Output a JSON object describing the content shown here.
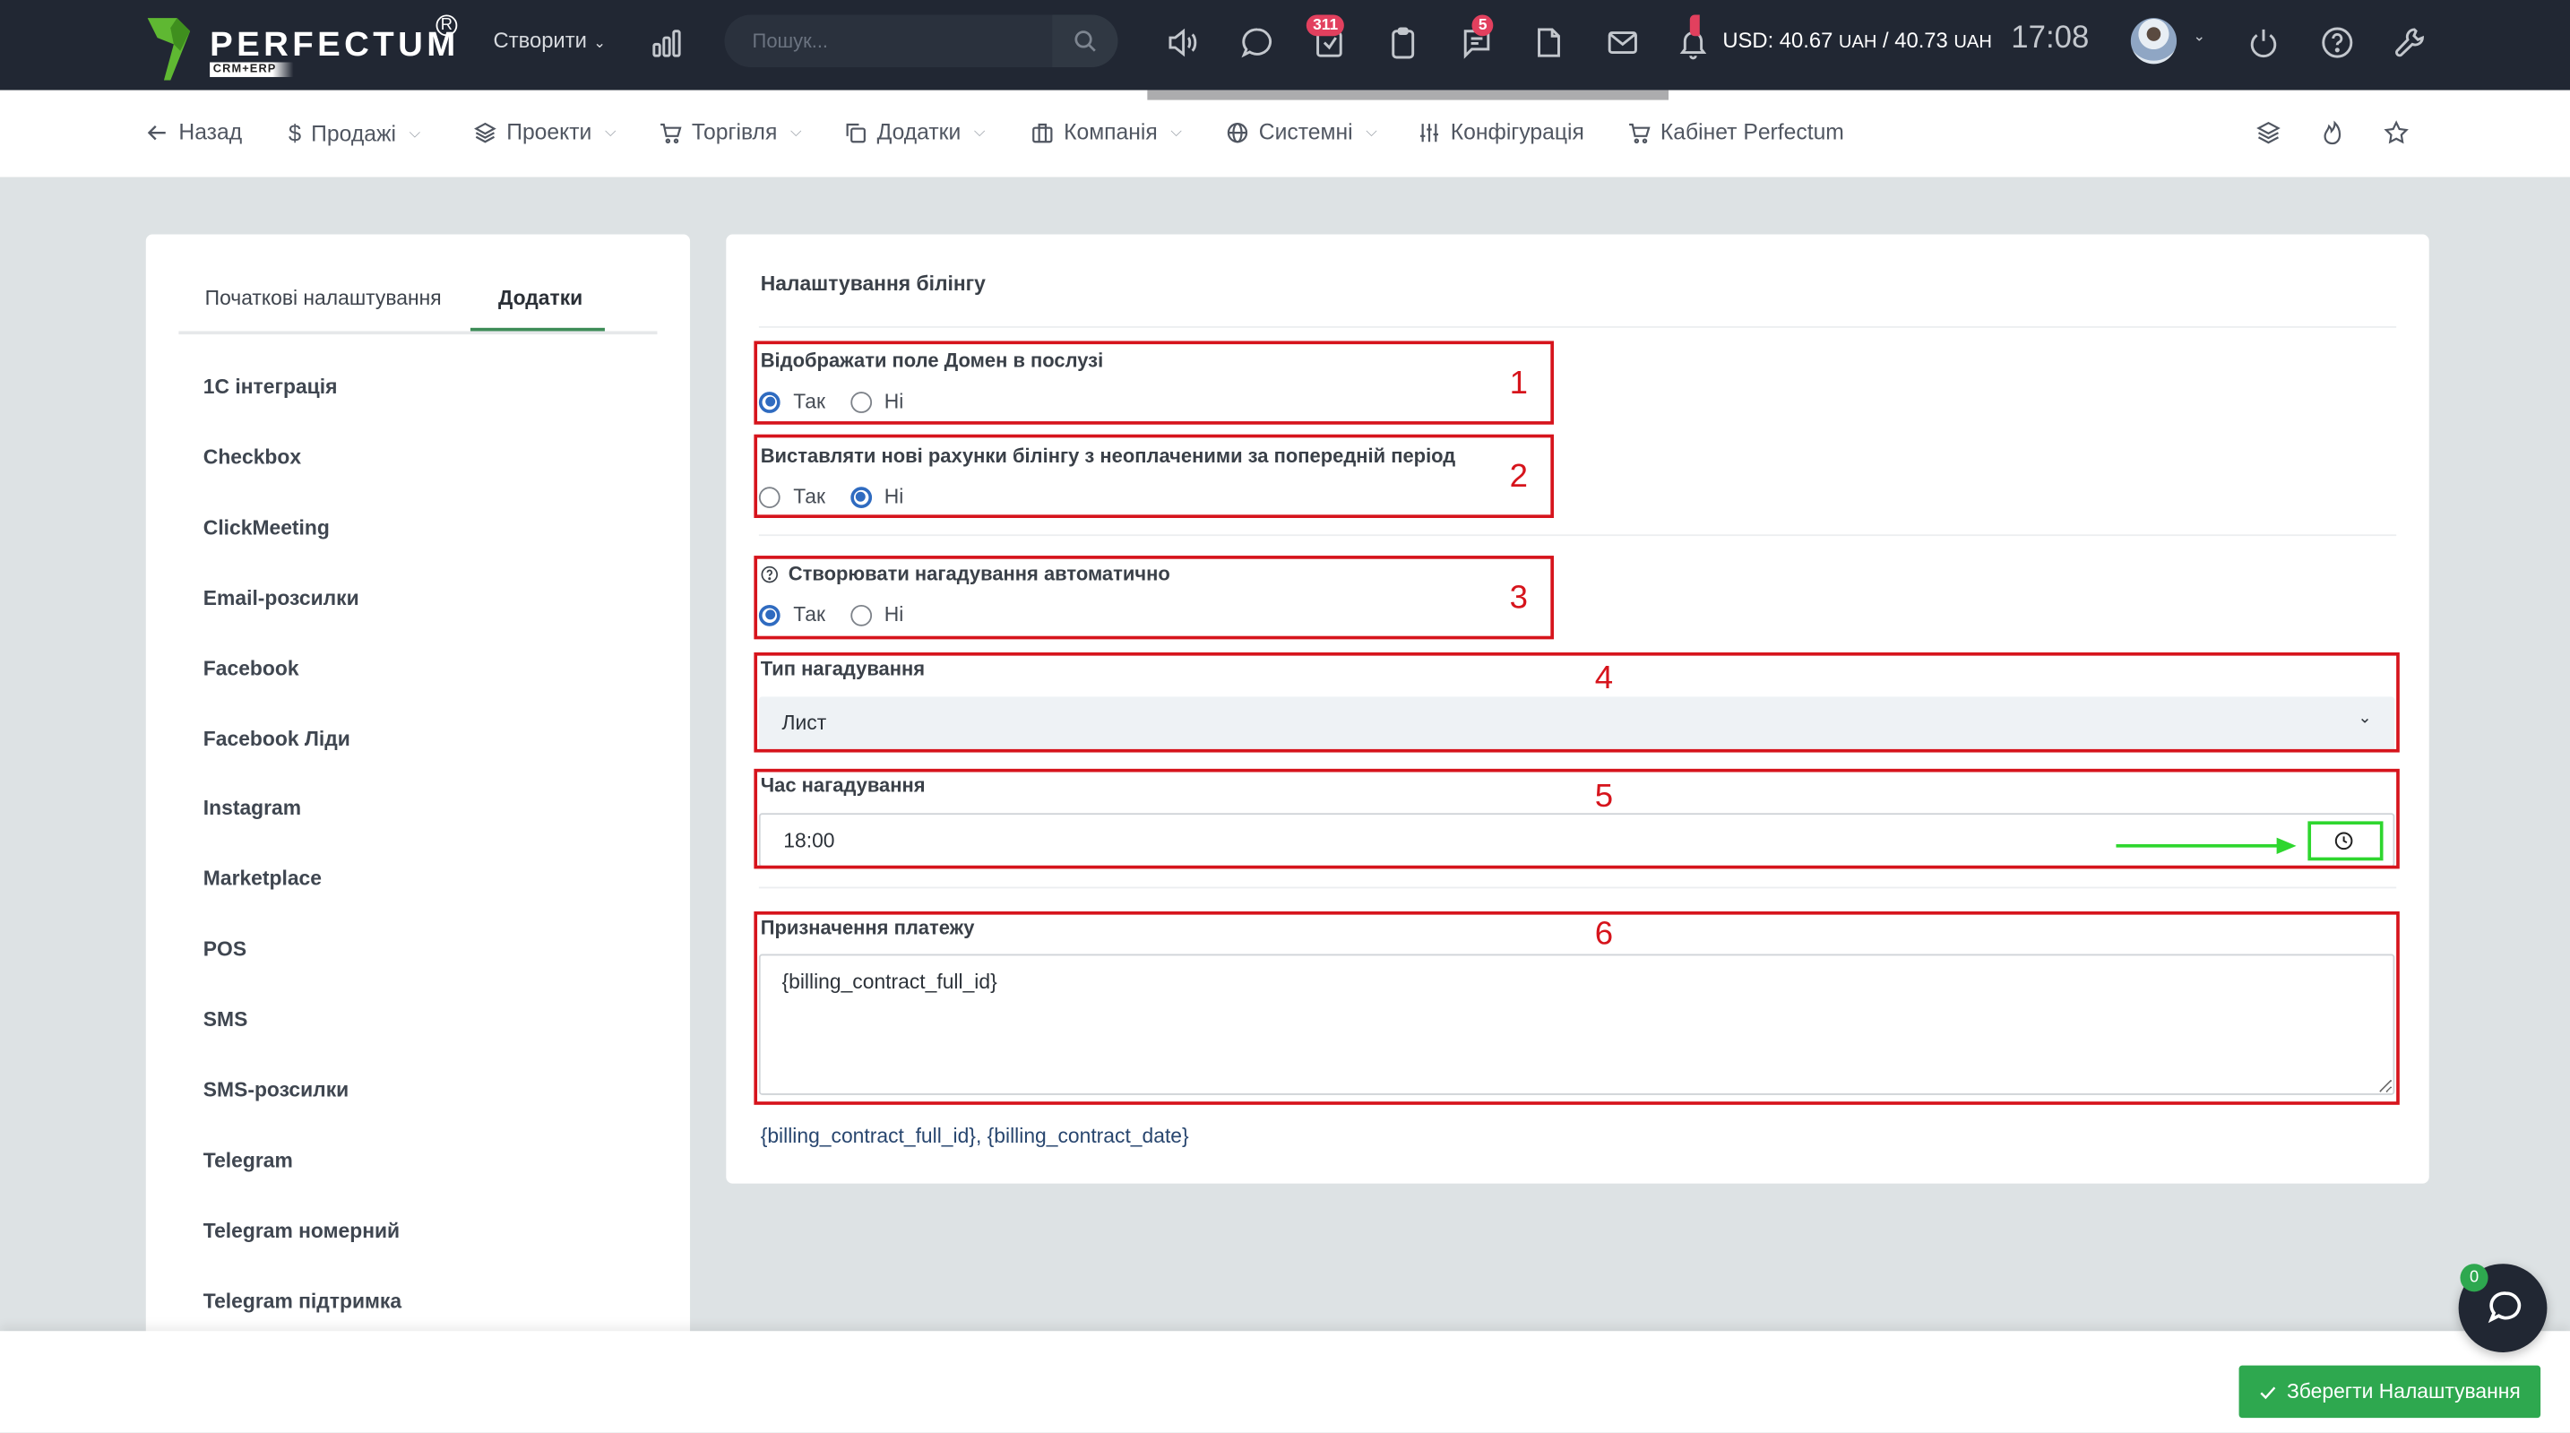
{
  "header": {
    "logo": {
      "brand": "PERFECTUM",
      "sub": "CRM+ERP",
      "reg": "R"
    },
    "create_label": "Створити",
    "search": {
      "placeholder": "Пошук..."
    },
    "icons": [
      {
        "name": "volume-icon"
      },
      {
        "name": "chat-bubble-icon"
      },
      {
        "name": "tasks-check-icon",
        "badge": "311"
      },
      {
        "name": "clipboard-icon"
      },
      {
        "name": "messages-icon",
        "badge": "5"
      },
      {
        "name": "document-icon"
      },
      {
        "name": "mail-icon"
      },
      {
        "name": "bell-icon"
      }
    ],
    "currency": {
      "prefix": "USD: 40.67 ",
      "u1": "UAH",
      "mid": " / 40.73 ",
      "u2": "UAH"
    },
    "time": "17:08"
  },
  "subnav": {
    "items": [
      {
        "label": "Назад",
        "icon": "arrow-left-icon",
        "dropdown": false
      },
      {
        "label": "Продажі",
        "icon": "dollar-icon",
        "dropdown": true
      },
      {
        "label": "Проекти",
        "icon": "layers-icon",
        "dropdown": true
      },
      {
        "label": "Торгівля",
        "icon": "cart-icon",
        "dropdown": true
      },
      {
        "label": "Додатки",
        "icon": "copy-icon",
        "dropdown": true
      },
      {
        "label": "Компанія",
        "icon": "building-icon",
        "dropdown": true
      },
      {
        "label": "Системні",
        "icon": "globe-icon",
        "dropdown": true
      },
      {
        "label": "Конфігурація",
        "icon": "sliders-icon",
        "dropdown": false
      },
      {
        "label": "Кабінет Perfectum",
        "icon": "cart-icon",
        "dropdown": false
      }
    ]
  },
  "sidebar": {
    "tabs": [
      {
        "label": "Початкові налаштування",
        "active": false
      },
      {
        "label": "Додатки",
        "active": true
      }
    ],
    "items": [
      "1С інтеграція",
      "Checkbox",
      "ClickMeeting",
      "Email-розсилки",
      "Facebook",
      "Facebook Ліди",
      "Instagram",
      "Marketplace",
      "POS",
      "SMS",
      "SMS-розсилки",
      "Telegram",
      "Telegram номерний",
      "Telegram підтримка"
    ]
  },
  "main": {
    "title": "Налаштування білінгу",
    "fields": {
      "show_domain": {
        "label": "Відображати поле Домен в послузі",
        "options": [
          "Так",
          "Ні"
        ],
        "selected": "Так"
      },
      "new_invoices": {
        "label": "Виставляти нові рахунки білінгу з неоплаченими за попередній період",
        "options": [
          "Так",
          "Ні"
        ],
        "selected": "Ні"
      },
      "auto_reminders": {
        "label": "Створювати нагадування автоматично",
        "options": [
          "Так",
          "Ні"
        ],
        "selected": "Так"
      },
      "reminder_type": {
        "label": "Тип нагадування",
        "value": "Лист"
      },
      "reminder_time": {
        "label": "Час нагадування",
        "value": "18:00"
      },
      "payment_purpose": {
        "label": "Призначення платежу",
        "value": "{billing_contract_full_id}"
      }
    },
    "vars_hint": "{billing_contract_full_id}, {billing_contract_date}",
    "annotations": [
      "1",
      "2",
      "3",
      "4",
      "5",
      "6"
    ]
  },
  "footer": {
    "save_label": "Зберегти Налаштування"
  },
  "chat": {
    "badge": "0"
  },
  "colors": {
    "header_bg": "#212733",
    "accent_green": "#2ea84f",
    "annotation_red": "#d6141c",
    "highlight_green": "#2ed62e",
    "radio_blue": "#2f6bc0",
    "badge_red": "#e2405e"
  }
}
